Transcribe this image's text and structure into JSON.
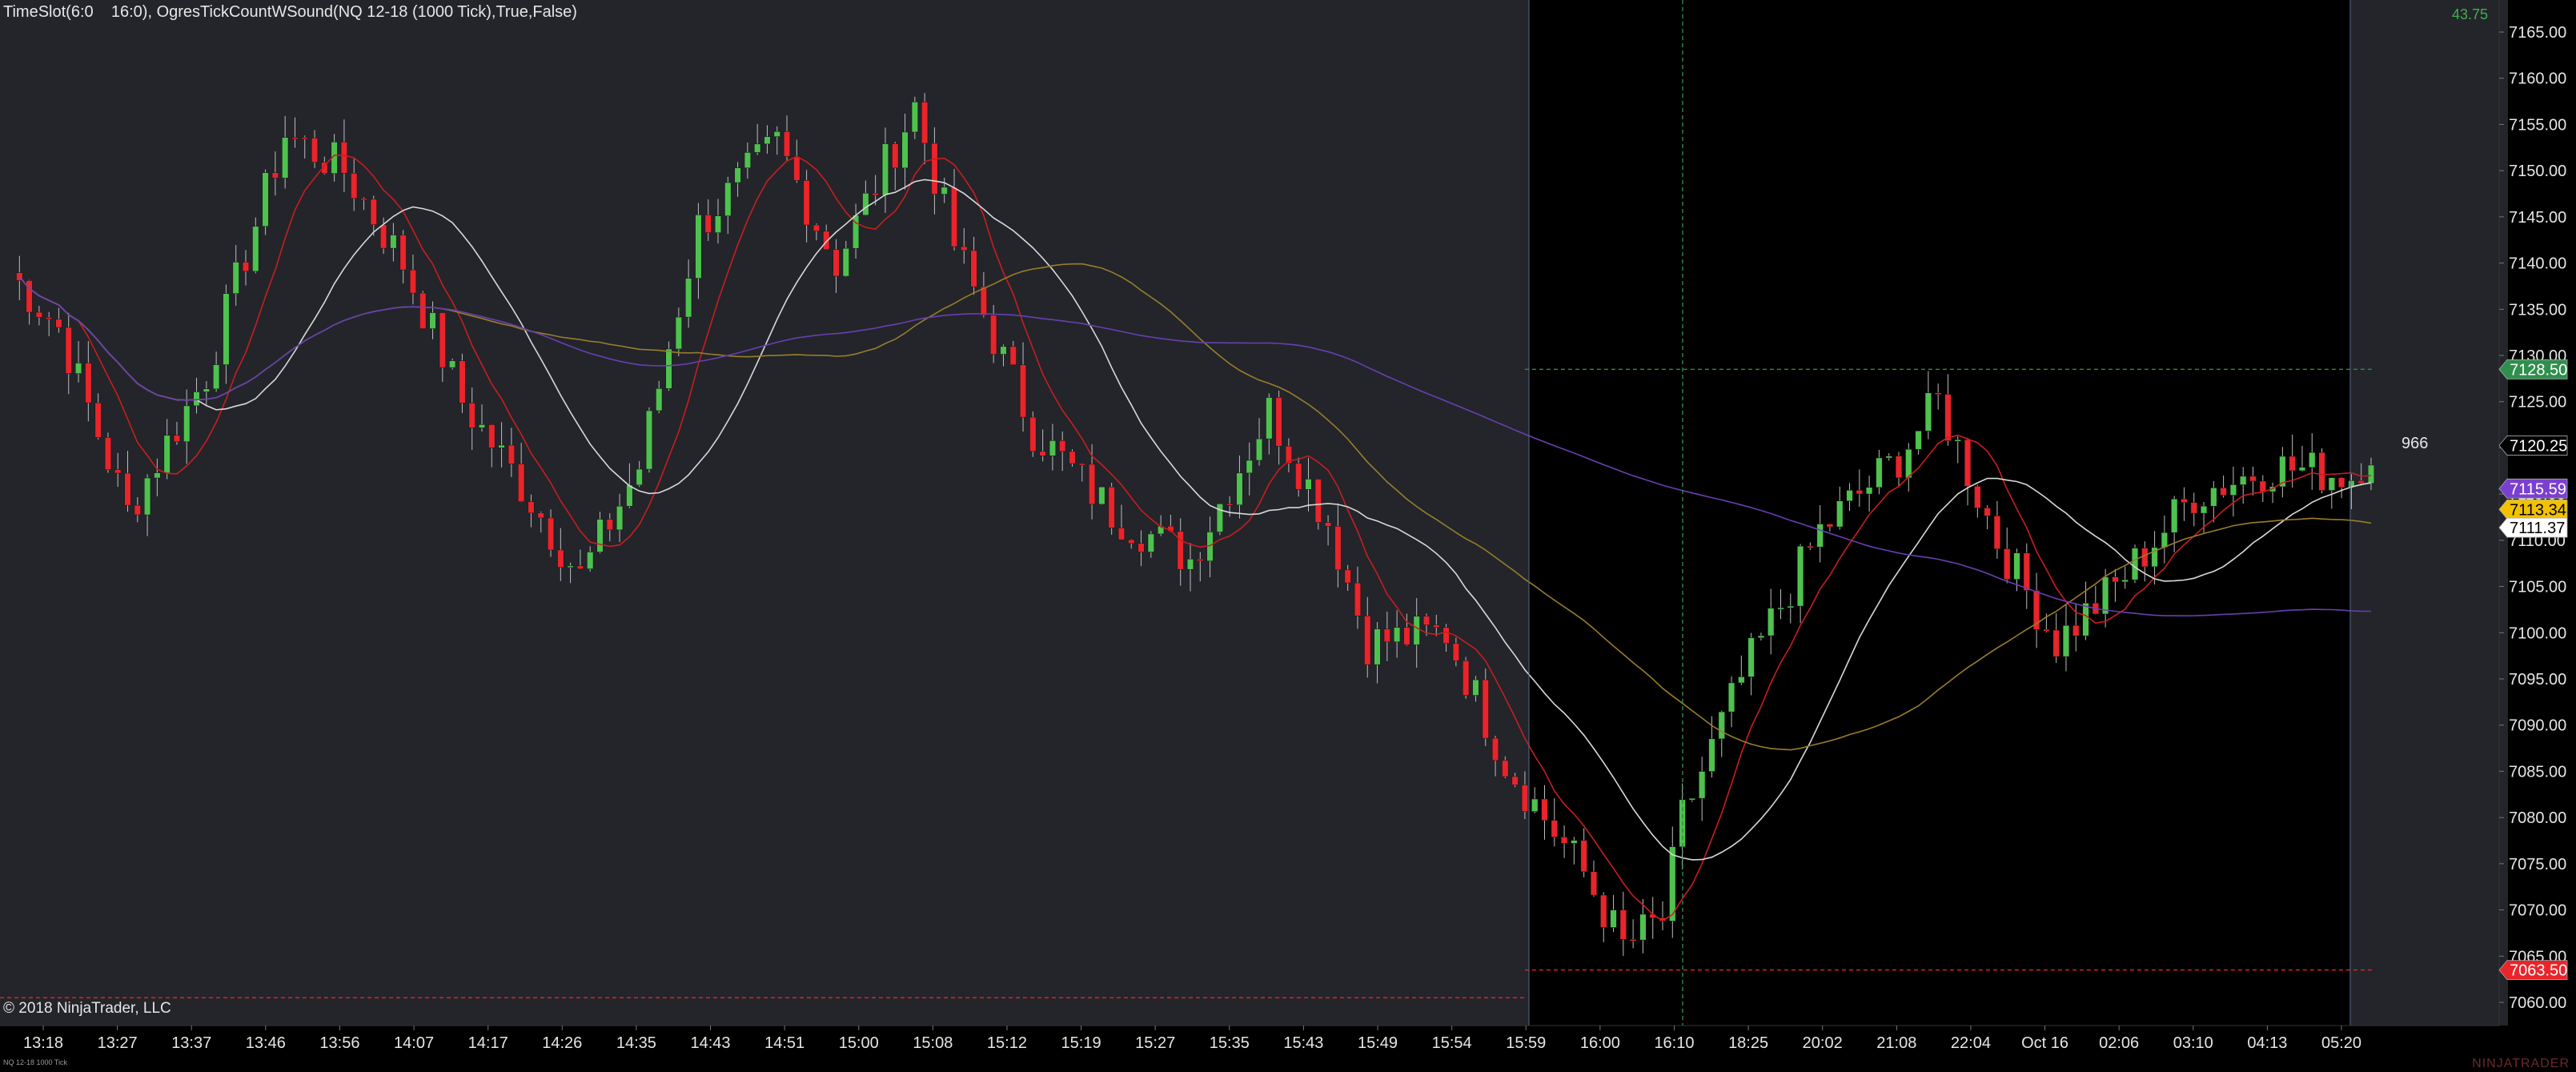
{
  "header": {
    "template": "TimeSlot(6:0    16:0)",
    "indicator": "OgresTickCountWSound(NQ 12-18 (1000 Tick),True,False)"
  },
  "indicator_value": "43.75",
  "copyright": "© 2018 NinjaTrader, LLC",
  "instrument_tag": "NQ 12-18 1000 Tick",
  "brand": "NINJATRADER",
  "tick_remaining": "966",
  "colors": {
    "bg_session": "#23252b",
    "bg_off": "#000000",
    "up": "#4ec24e",
    "down": "#e9242b",
    "ma_fast": "#c81e1e",
    "ma_mid": "#d9d9d9",
    "ma_slow": "#9a7d2a",
    "ma_long": "#6a3fb0"
  },
  "price_axis": {
    "ticks": [
      "7165.00",
      "7160.00",
      "7155.00",
      "7150.00",
      "7145.00",
      "7140.00",
      "7135.00",
      "7130.00",
      "7125.00",
      "7120.00",
      "7115.00",
      "7110.00",
      "7105.00",
      "7100.00",
      "7095.00",
      "7090.00",
      "7085.00",
      "7080.00",
      "7075.00",
      "7070.00",
      "7065.00",
      "7060.00"
    ],
    "markers": [
      {
        "label": "7128.50",
        "price": 7128.5,
        "color": "#2f8f4c",
        "text_color": "#ffffff"
      },
      {
        "label": "7120.25",
        "price": 7120.25,
        "color": "#000000",
        "text_color": "#ffffff"
      },
      {
        "label": "7115.59",
        "price": 7115.59,
        "color": "#7b3fd0",
        "text_color": "#ffffff"
      },
      {
        "label": "7113.34",
        "price": 7113.34,
        "color": "#f2c200",
        "text_color": "#000000"
      },
      {
        "label": "7111.37",
        "price": 7111.37,
        "color": "#ffffff",
        "text_color": "#000000"
      },
      {
        "label": "7063.50",
        "price": 7063.5,
        "color": "#e9242b",
        "text_color": "#ffffff"
      }
    ]
  },
  "time_axis": {
    "labels": [
      "13:18",
      "13:27",
      "13:37",
      "13:46",
      "13:56",
      "14:07",
      "14:17",
      "14:26",
      "14:35",
      "14:43",
      "14:51",
      "15:00",
      "15:08",
      "15:12",
      "15:19",
      "15:27",
      "15:35",
      "15:43",
      "15:49",
      "15:54",
      "15:59",
      "16:00",
      "16:10",
      "18:25",
      "20:02",
      "21:08",
      "22:04",
      "Oct 16",
      "02:06",
      "03:10",
      "04:13",
      "05:20"
    ]
  },
  "chart_data": {
    "type": "candlestick",
    "y_range": [
      7058.5,
      7167.5
    ],
    "x_count": 240,
    "session_break_index": 154,
    "levels": {
      "range_high": 7128.5,
      "range_low": 7063.5,
      "prior_low": 7060.5
    },
    "close_path": [
      [
        0,
        7139
      ],
      [
        5,
        7133
      ],
      [
        12,
        7113
      ],
      [
        20,
        7128
      ],
      [
        28,
        7154
      ],
      [
        34,
        7150
      ],
      [
        40,
        7140
      ],
      [
        46,
        7125
      ],
      [
        52,
        7116
      ],
      [
        58,
        7106
      ],
      [
        64,
        7118
      ],
      [
        70,
        7144
      ],
      [
        78,
        7153
      ],
      [
        84,
        7140
      ],
      [
        92,
        7157
      ],
      [
        96,
        7142
      ],
      [
        104,
        7122
      ],
      [
        112,
        7113
      ],
      [
        120,
        7108
      ],
      [
        128,
        7124
      ],
      [
        134,
        7112
      ],
      [
        138,
        7099
      ],
      [
        146,
        7100
      ],
      [
        152,
        7086
      ],
      [
        160,
        7074
      ],
      [
        164,
        7066
      ],
      [
        168,
        7069
      ],
      [
        170,
        7080
      ],
      [
        176,
        7095
      ],
      [
        184,
        7111
      ],
      [
        192,
        7119
      ],
      [
        196,
        7125
      ],
      [
        202,
        7110
      ],
      [
        208,
        7099
      ],
      [
        214,
        7105
      ],
      [
        222,
        7115
      ],
      [
        230,
        7118
      ],
      [
        238,
        7117
      ],
      [
        240,
        7120
      ]
    ]
  }
}
